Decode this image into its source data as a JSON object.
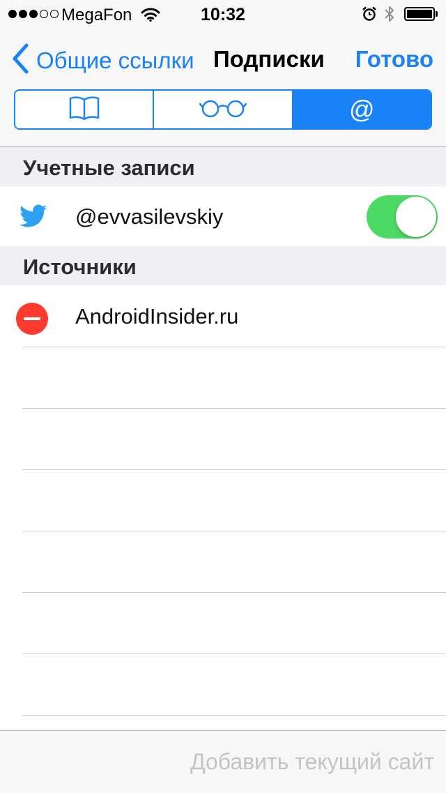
{
  "status_bar": {
    "carrier": "MegaFon",
    "time": "10:32",
    "signal_strength": 3,
    "signal_max": 5,
    "icons": [
      "wifi-icon",
      "alarm-icon",
      "bluetooth-icon",
      "battery-icon"
    ],
    "battery_level": 1.0
  },
  "nav": {
    "back_label": "Общие ссылки",
    "title": "Подписки",
    "done_label": "Готово"
  },
  "segmented": {
    "selected_index": 2,
    "segments": [
      {
        "icon": "book-icon"
      },
      {
        "icon": "glasses-icon"
      },
      {
        "icon": "at-icon",
        "label": "@"
      }
    ]
  },
  "accounts": {
    "header": "Учетные записи",
    "items": [
      {
        "icon": "twitter-icon",
        "label": "@evvasilevskiy",
        "enabled": true
      }
    ]
  },
  "sources": {
    "header": "Источники",
    "items": [
      {
        "label": "AndroidInsider.ru",
        "action": "delete"
      }
    ]
  },
  "toolbar": {
    "add_site_label": "Добавить текущий сайт"
  },
  "colors": {
    "accent": "#1a82f7",
    "toggle_on": "#4cd964",
    "delete": "#ff3b30",
    "twitter": "#2ea2f0",
    "disabled_text": "#c4c4c6",
    "section_bg": "#efeff4"
  }
}
